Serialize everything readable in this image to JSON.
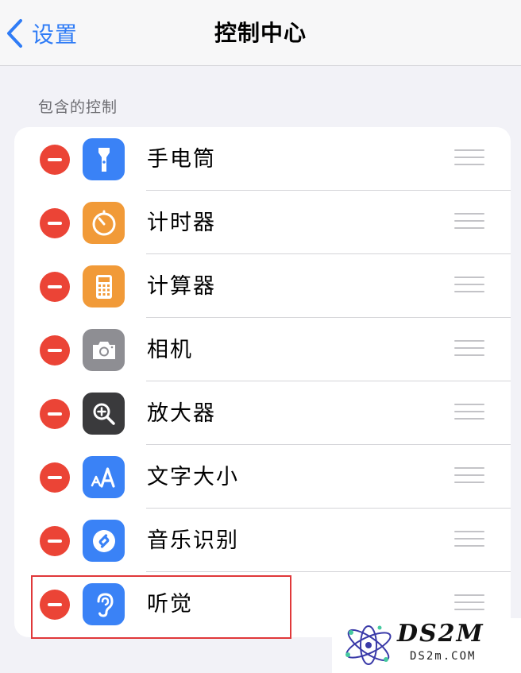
{
  "nav": {
    "back_label": "设置",
    "title": "控制中心"
  },
  "section": {
    "header": "包含的控制"
  },
  "items": [
    {
      "label": "手电筒",
      "icon": "flashlight-icon",
      "color": "#3a82f6"
    },
    {
      "label": "计时器",
      "icon": "timer-icon",
      "color": "#f19a38"
    },
    {
      "label": "计算器",
      "icon": "calculator-icon",
      "color": "#f19a38"
    },
    {
      "label": "相机",
      "icon": "camera-icon",
      "color": "#8e8e93"
    },
    {
      "label": "放大器",
      "icon": "magnifier-icon",
      "color": "#3a3a3c"
    },
    {
      "label": "文字大小",
      "icon": "text-size-icon",
      "color": "#3a82f6"
    },
    {
      "label": "音乐识别",
      "icon": "shazam-icon",
      "color": "#3a82f6"
    },
    {
      "label": "听觉",
      "icon": "ear-icon",
      "color": "#3a82f6"
    }
  ],
  "colors": {
    "accent": "#2f7cf6",
    "remove": "#eb4436",
    "highlight": "#e0383a"
  },
  "watermark": {
    "brand": "DS2M",
    "url": "DS2m.COM"
  }
}
